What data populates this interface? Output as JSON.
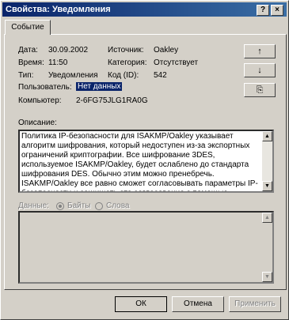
{
  "window": {
    "title": "Свойства: Уведомления",
    "help_btn": "?",
    "close_btn": "×"
  },
  "tabs": [
    {
      "label": "Событие"
    }
  ],
  "fields": {
    "date_label": "Дата:",
    "date_value": "30.09.2002",
    "time_label": "Время:",
    "time_value": "11:50",
    "type_label": "Тип:",
    "type_value": "Уведомления",
    "user_label": "Пользователь:",
    "user_value": "Нет данных",
    "computer_label": "Компьютер:",
    "computer_value": "2-6FG75JLG1RA0G",
    "source_label": "Источник:",
    "source_value": "Oakley",
    "category_label": "Категория:",
    "category_value": "Отсутствует",
    "code_label": "Код (ID):",
    "code_value": "542"
  },
  "side_buttons": {
    "up": "↑",
    "down": "↓",
    "copy": "⎘"
  },
  "description": {
    "label": "Описание:",
    "text": "Политика IP-безопасности для ISAKMP/Oakley указывает\nалгоритм шифрования, который недоступен из-за экспортных\nограничений криптографии. Все шифрование 3DES,\nиспользуемое ISAKMP/Oakley, будет ослаблено до стандарта\nшифрования DES. Обычно этим можно пренебречь.\nISAKMP/Oakley все равно сможет согласовывать параметры IP-\nбезопасности и защищать это согласование с помощью"
  },
  "data_section": {
    "label": "Данные:",
    "bytes": "Байты",
    "words": "Слова"
  },
  "buttons": {
    "ok": "ОК",
    "cancel": "Отмена",
    "apply": "Применить"
  },
  "colors": {
    "titlebar": "#0a246a",
    "face": "#d4d0c8",
    "selection": "#0a246a"
  }
}
